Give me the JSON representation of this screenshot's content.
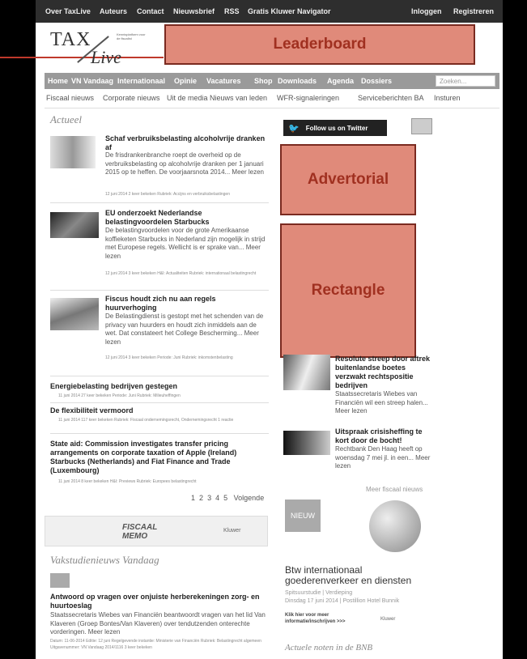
{
  "topbar": {
    "links": [
      "Over TaxLive",
      "Auteurs",
      "Contact",
      "Nieuwsbrief",
      "RSS",
      "Gratis Kluwer Navigator"
    ],
    "login": "Inloggen",
    "register": "Registreren"
  },
  "logo": {
    "tax": "TAX",
    "live": "Live",
    "tagline": "Kennisplatform voor de fiscalist"
  },
  "ads": {
    "leaderboard": "Leaderboard",
    "advertorial": "Advertorial",
    "rectangle": "Rectangle"
  },
  "nav": {
    "items": [
      "Home",
      "VN Vandaag",
      "Internationaal",
      "Opinie",
      "Vacatures",
      "Shop",
      "Downloads",
      "Agenda",
      "Dossiers"
    ],
    "search_placeholder": "Zoeken..."
  },
  "subnav": [
    "Fiscaal nieuws",
    "Corporate nieuws",
    "Uit de media",
    "Nieuws van leden",
    "WFR-signaleringen",
    "Serviceberichten BA",
    "Insturen"
  ],
  "actueel": {
    "heading": "Actueel",
    "articles": [
      {
        "title": "Schaf verbruiksbelasting alcoholvrije dranken af",
        "text": "De frisdrankenbranche roept de overheid op de verbruiksbelasting op alcoholvrije dranken per 1 januari 2015 op te heffen. De voorjaarsnota 2014... Meer lezen",
        "meta": "12 juni 2014   2 keer bekeken   Rubriek: Accijns en verbruiksbelastingen"
      },
      {
        "title": "EU onderzoekt Nederlandse belastingvoordelen Starbucks",
        "text": "De belastingvoordelen voor de grote Amerikaanse koffieketen Starbucks in Nederland zijn mogelijk in strijd met Europese regels. Wellicht is er sprake van... Meer lezen",
        "meta": "12 juni 2014   3 keer bekeken   H&I: Actualiteiten   Rubriek: internationaal belastingrecht"
      },
      {
        "title": "Fiscus houdt zich nu aan regels huurverhoging",
        "text": "De Belastingdienst is gestopt met het schenden van de privacy van huurders en houdt zich inmiddels aan de wet. Dat constateert het College Bescherming... Meer lezen",
        "meta": "12 juni 2014   3 keer bekeken   Periode: Juni   Rubriek: inkomstenbelasting"
      }
    ],
    "short": [
      {
        "title": "Energiebelasting bedrijven gestegen",
        "meta": "11 juni 2014   27 keer bekeken   Periode: Juni   Rubriek: Milieuheffingen"
      },
      {
        "title": "De flexibiliteit vermoord",
        "meta": "11 juni 2014   117 keer bekeken   Rubriek: Fiscaal ondernemingsrecht, Ondernemingsrecht   1 reactie"
      },
      {
        "title": "State aid: Commission investigates transfer pricing arrangements on corporate taxation of Apple (Ireland) Starbucks (Netherlands) and Fiat Finance and Trade (Luxembourg)",
        "meta": "11 juni 2014   8 keer bekeken   H&I: Previews   Rubriek: Europees belastingrecht"
      }
    ],
    "pagination": [
      "1",
      "2",
      "3",
      "4",
      "5"
    ],
    "next": "Volgende"
  },
  "vakstudie": {
    "heading": "Vakstudienieuws Vandaag",
    "title": "Antwoord op vragen over onjuiste herberekeningen zorg- en huurtoeslag",
    "text": "Staatssecretaris Wiebes van Financiën beantwoordt vragen van het lid Van Klaveren (Groep Bontes/Van Klaveren) over tendutzenden onterechte vorderingen. Meer lezen",
    "meta": "Datum: 11-06-2014   Editie: 12 juni   Regelgevende instantie: Ministerie van Financiën   Rubriek: Belastingrecht algemeen   Uitgavenummer: VN Vandaag 2014/1116   3 keer bekeken"
  },
  "sidebar": {
    "twitter": "Follow us on Twitter",
    "articles": [
      {
        "title": "Resolute streep door aftrek buitenlandse boetes verzwakt rechtspositie bedrijven",
        "text": "Staatssecretaris Wiebes van Financiën wil een streep halen... Meer lezen"
      },
      {
        "title": "Uitspraak crisisheffing te kort door de bocht!",
        "text": "Rechtbank Den Haag heeft op woensdag 7 mei jl. in een... Meer lezen"
      }
    ],
    "more": "Meer fiscaal nieuws",
    "nieuw": "NIEUW",
    "btw_title": "Btw internationaal goederenverkeer en diensten",
    "btw_sub": "Spitsuurstudie | Verdieping",
    "btw_date": "Dinsdag 17 juni 2014 | Postillion Hotel Bunnik",
    "btw_link": "Klik hier voor meer informatie/inschrijven >>>",
    "kluwer": "Kluwer",
    "noten_heading": "Actuele noten in de BNB"
  },
  "banner": {
    "text": "FISCAAL MEMO",
    "brand": "Kluwer"
  },
  "colors": {
    "adfill": "#e08a7a",
    "adborder": "#7a2a20",
    "nav": "#9a9a9a",
    "topbar": "#2e2e2e"
  }
}
